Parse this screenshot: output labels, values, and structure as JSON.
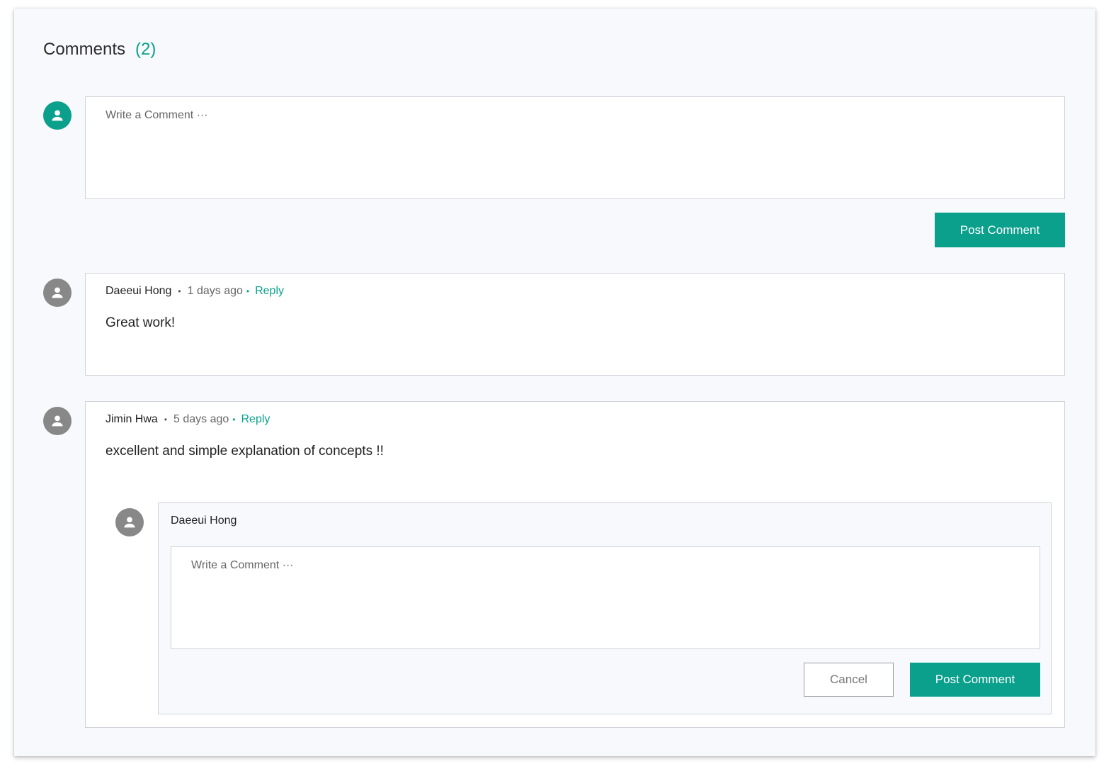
{
  "header": {
    "title": "Comments",
    "count": "(2)"
  },
  "composer": {
    "placeholder": "Write a Comment ···",
    "post_label": "Post Comment"
  },
  "comments": [
    {
      "author": "Daeeui Hong",
      "time": "1 days ago",
      "reply_label": "Reply",
      "text": "Great work!"
    },
    {
      "author": "Jimin Hwa",
      "time": "5 days ago",
      "reply_label": "Reply",
      "text": "excellent and simple explanation of concepts !!"
    }
  ],
  "reply_form": {
    "author": "Daeeui Hong",
    "placeholder": "Write a Comment ···",
    "cancel_label": "Cancel",
    "post_label": "Post Comment"
  },
  "icons": {
    "avatar": "user-avatar-icon"
  },
  "colors": {
    "accent": "#0aa08c",
    "avatar_gray": "#888888",
    "panel_bg": "#f8f9fc",
    "border": "#cfd2d8"
  }
}
